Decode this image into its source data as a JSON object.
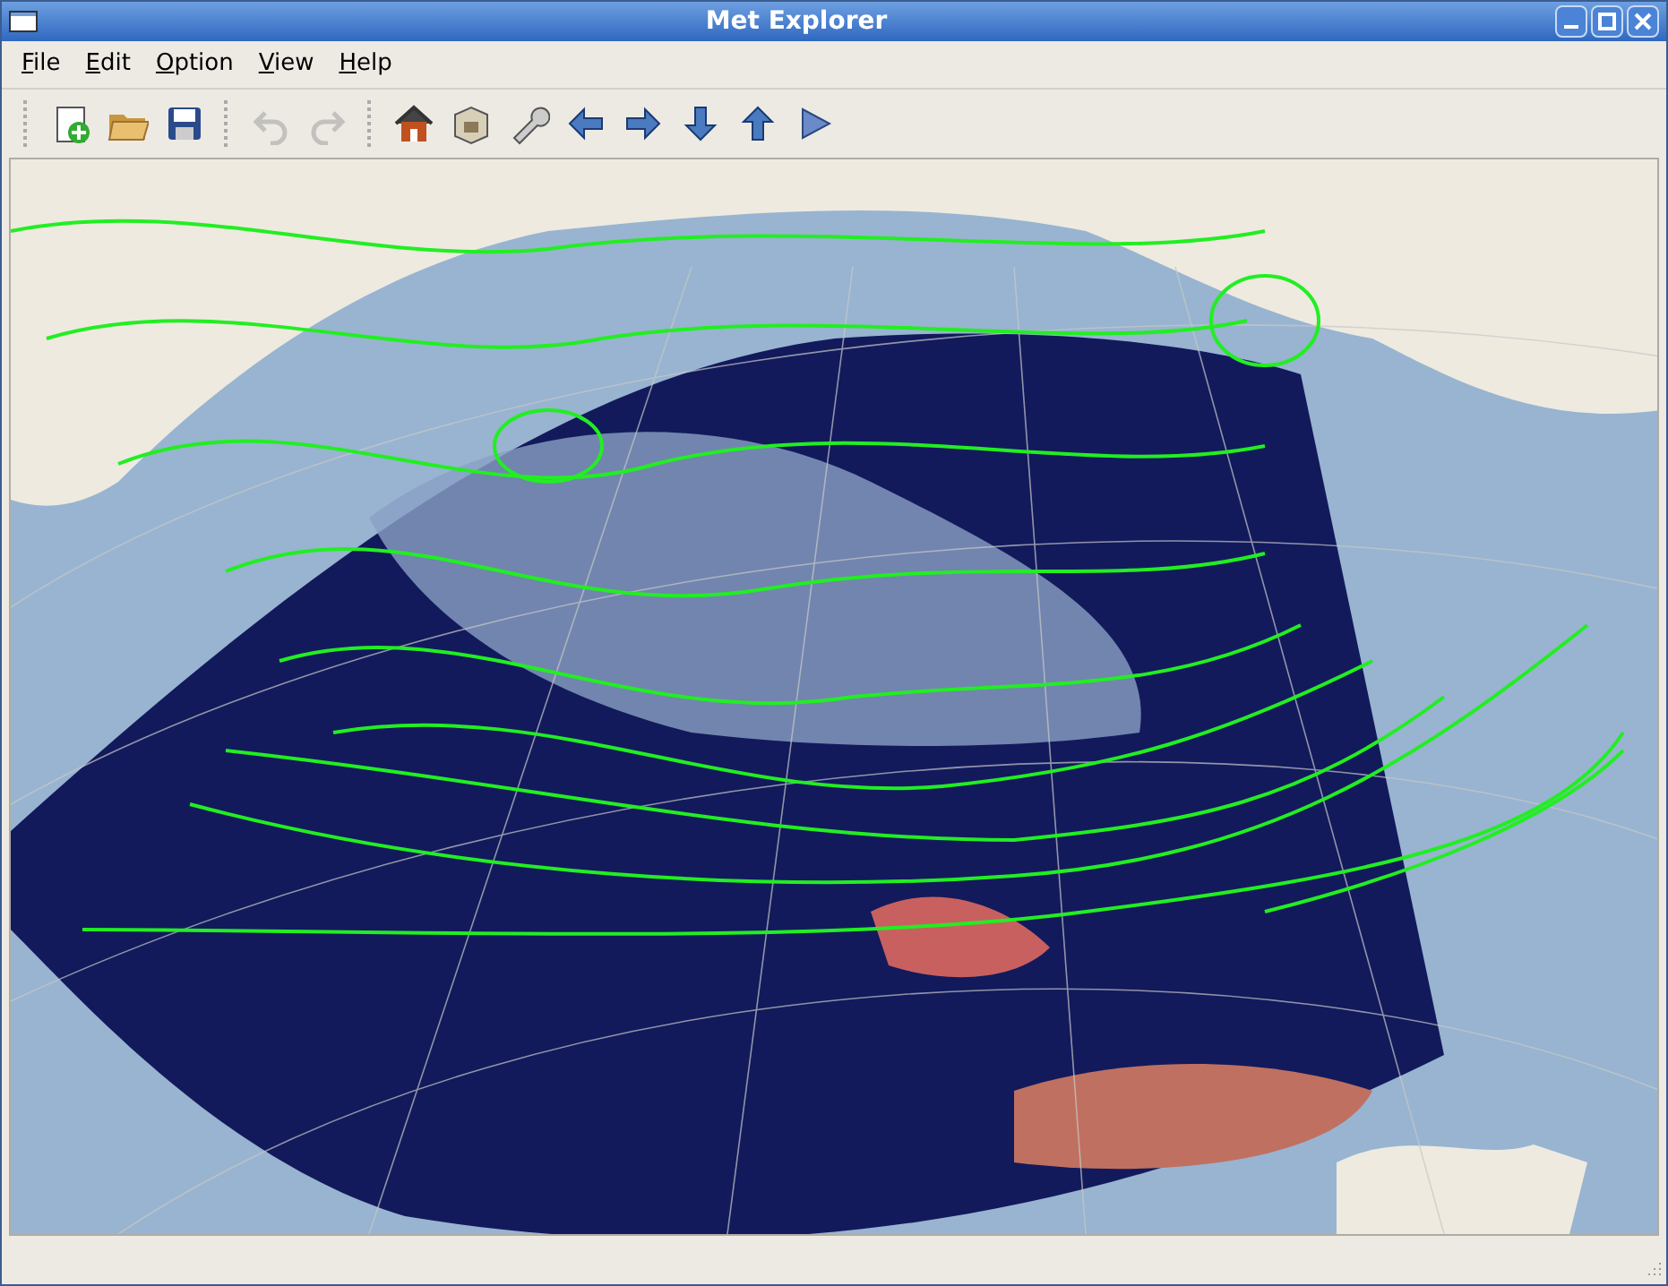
{
  "window": {
    "title": "Met Explorer"
  },
  "menu": [
    {
      "label": "File"
    },
    {
      "label": "Edit"
    },
    {
      "label": "Option"
    },
    {
      "label": "View"
    },
    {
      "label": "Help"
    }
  ],
  "toolbar_groups": [
    {
      "items": [
        {
          "kind": "new",
          "disabled": false
        },
        {
          "kind": "open",
          "disabled": false
        },
        {
          "kind": "save",
          "disabled": false
        }
      ]
    },
    {
      "items": [
        {
          "kind": "undo",
          "disabled": true
        },
        {
          "kind": "redo",
          "disabled": true
        }
      ]
    },
    {
      "items": [
        {
          "kind": "home",
          "disabled": false
        },
        {
          "kind": "box",
          "disabled": false
        },
        {
          "kind": "wrench",
          "disabled": false
        },
        {
          "kind": "left",
          "disabled": false
        },
        {
          "kind": "right",
          "disabled": false
        },
        {
          "kind": "down",
          "disabled": false
        },
        {
          "kind": "up",
          "disabled": false
        },
        {
          "kind": "play",
          "disabled": false
        }
      ]
    }
  ]
}
